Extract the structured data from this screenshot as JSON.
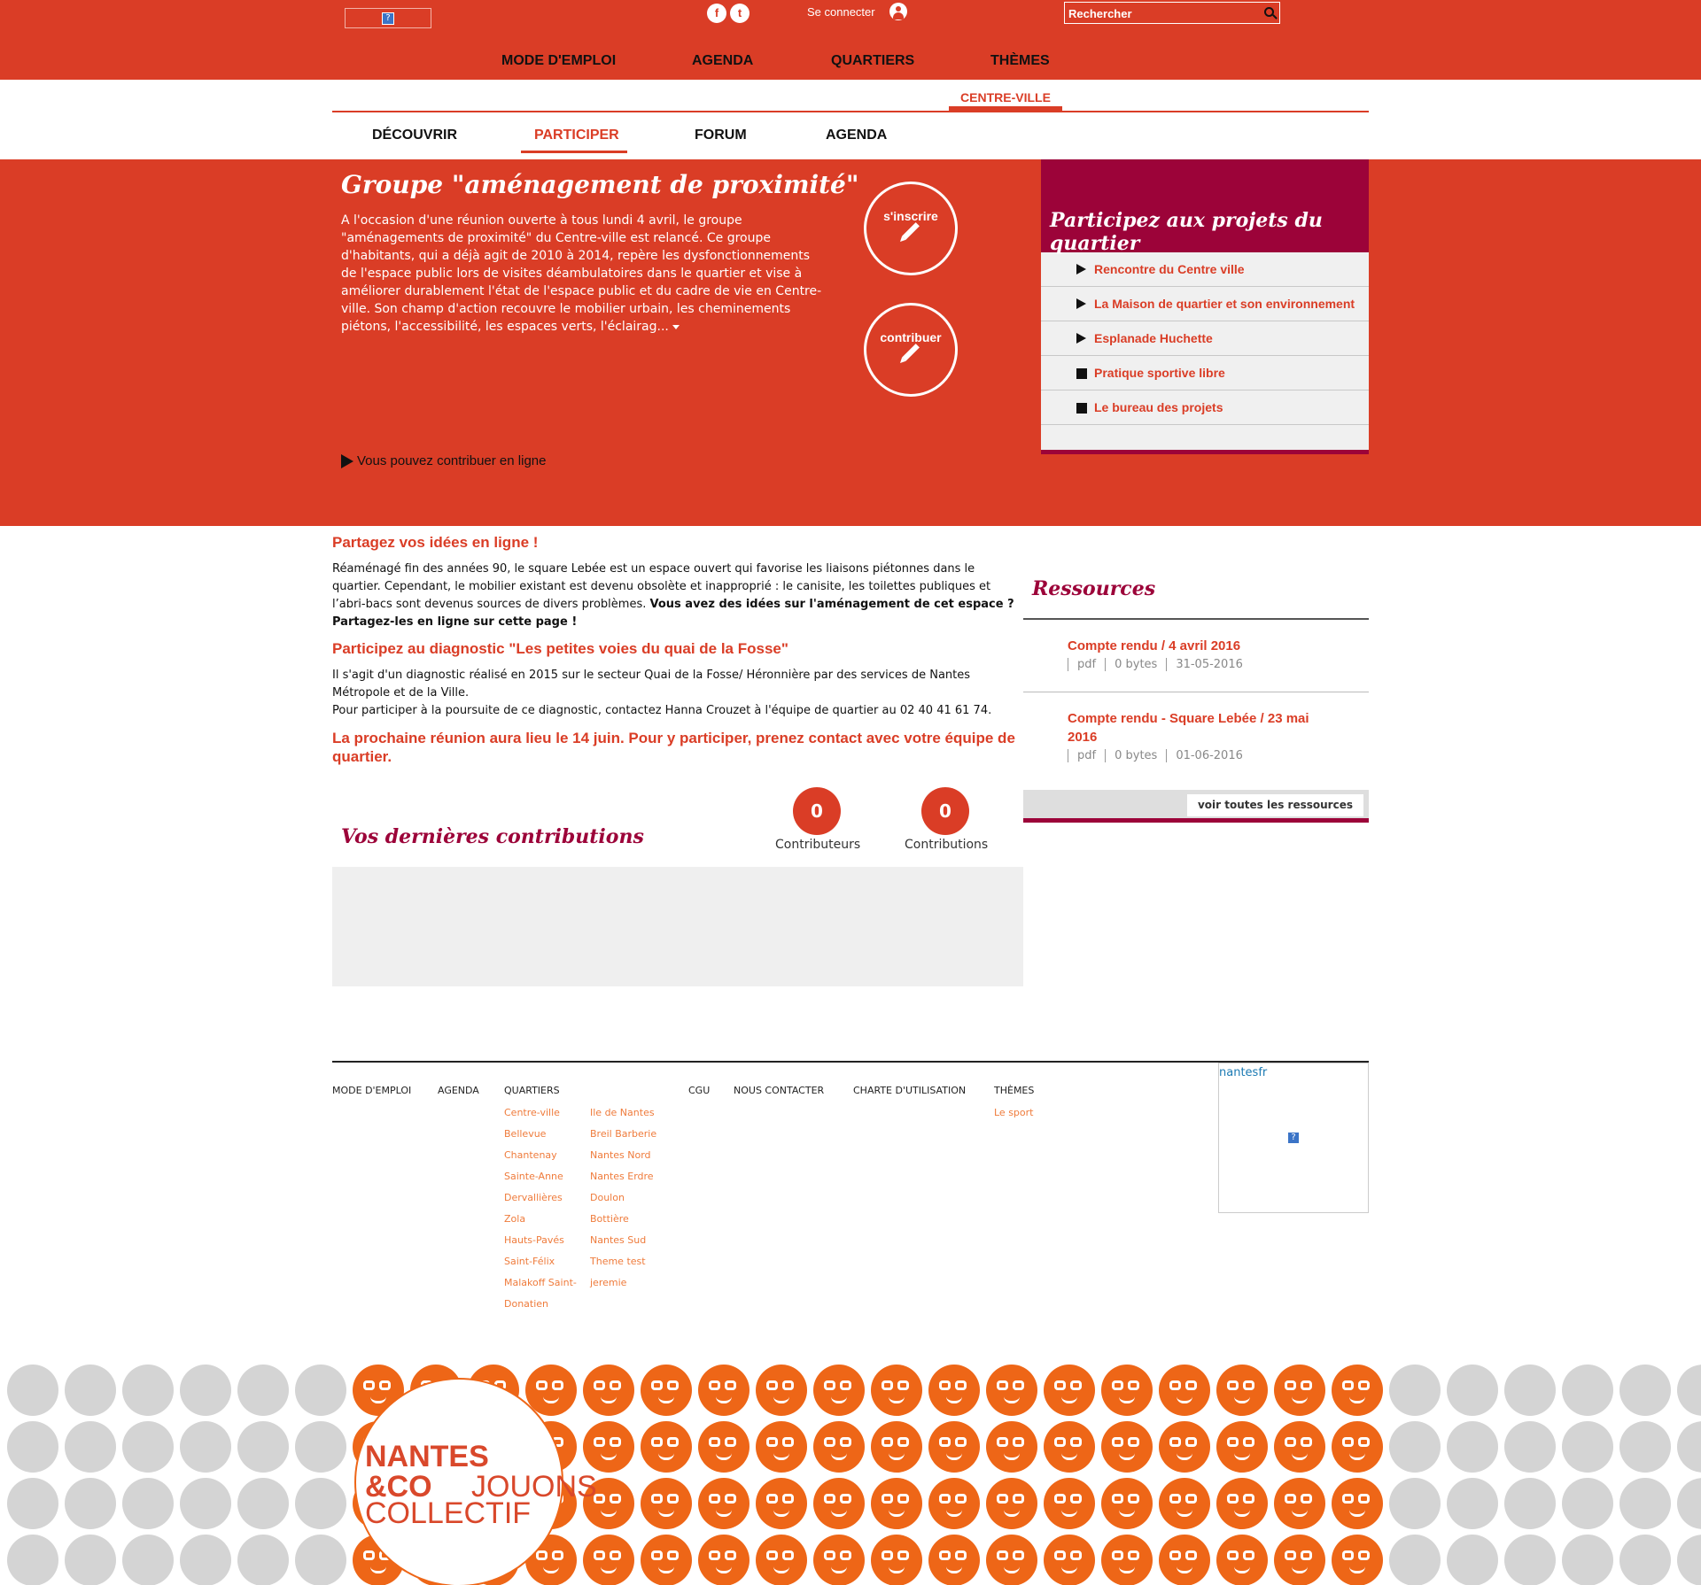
{
  "header": {
    "social": {
      "facebook": "f",
      "twitter": "t"
    },
    "login_label": "Se connecter",
    "search_placeholder": "Rechercher",
    "nav": [
      "MODE D'EMPLOI",
      "AGENDA",
      "QUARTIERS",
      "THÈMES"
    ]
  },
  "subheader": {
    "district": "CENTRE-VILLE",
    "tabs": [
      "DÉCOUVRIR",
      "PARTICIPER",
      "FORUM",
      "AGENDA"
    ],
    "active_tab": "PARTICIPER"
  },
  "hero": {
    "title": "Groupe \"aménagement de proximité\"",
    "text": "A l'occasion d'une réunion ouverte à tous lundi 4 avril, le groupe \"aménagements de proximité\" du Centre-ville est relancé. Ce groupe d'habitants, qui a déjà agit de 2010 à 2014, repère les dysfonctionnements de l'espace public lors de visites déambulatoires dans le quartier et vise à améliorer durablement l'état de l'espace public et du cadre de vie en Centre-ville. Son champ d'action recouvre le mobilier urbain, les cheminements piétons, l'accessibilité, les espaces verts, l'éclairag...",
    "subscribe_label": "s'inscrire",
    "contribute_label": "contribuer",
    "contribute_online": "Vous pouvez contribuer en ligne"
  },
  "projects": {
    "title": "Participez aux projets du quartier",
    "items": [
      {
        "label": "Rencontre du Centre ville",
        "marker": "triangle"
      },
      {
        "label": "La Maison de quartier et son environnement",
        "marker": "triangle"
      },
      {
        "label": "Esplanade Huchette",
        "marker": "triangle"
      },
      {
        "label": "Pratique sportive libre",
        "marker": "square"
      },
      {
        "label": "Le bureau des projets",
        "marker": "square"
      }
    ]
  },
  "content": {
    "section1_title": "Partagez vos idées en ligne !",
    "section1_text": "Réaménagé fin des années 90, le square Lebée est un espace ouvert qui favorise les liaisons piétonnes dans le quartier. Cependant, le mobilier existant est devenu obsolète et inapproprié : le canisite, les toilettes publiques et l’abri-bacs sont devenus sources de divers problèmes.",
    "section1_bold": "Vous avez des idées sur l'aménagement de cet espace ? Partagez-les en ligne sur cette page !",
    "section2_title": "Participez au diagnostic \"Les petites voies du quai de la Fosse\"",
    "section2_text1": "Il s'agit d'un diagnostic réalisé en 2015 sur le secteur Quai de la Fosse/ Héronnière par des services de Nantes Métropole et de la Ville.",
    "section2_text2": "Pour participer à la poursuite de ce diagnostic, contactez Hanna Crouzet à l'équipe de quartier au 02 40 41 61 74.",
    "section3_title": "La prochaine réunion aura lieu le 14 juin. Pour y participer, prenez contact avec votre équipe de quartier."
  },
  "resources": {
    "title": "Ressources",
    "items": [
      {
        "name": "Compte rendu / 4 avril 2016",
        "type": "pdf",
        "size": "0 bytes",
        "date": "31-05-2016"
      },
      {
        "name": "Compte rendu - Square Lebée / 23 mai 2016",
        "type": "pdf",
        "size": "0 bytes",
        "date": "01-06-2016"
      }
    ],
    "view_all": "voir toutes les ressources"
  },
  "contributions": {
    "title": "Vos dernières contributions",
    "contributors_count": "0",
    "contributors_label": "Contributeurs",
    "contributions_count": "0",
    "contributions_label": "Contributions"
  },
  "footer": {
    "nav": [
      "MODE D'EMPLOI",
      "AGENDA",
      "QUARTIERS",
      "CGU",
      "NOUS CONTACTER",
      "CHARTE D'UTILISATION",
      "THÈMES"
    ],
    "quartiers_col1": [
      "Centre-ville",
      "Bellevue",
      "Chantenay",
      "Sainte-Anne",
      "Dervallières",
      "Zola",
      "Hauts-Pavés",
      "Saint-Félix",
      "Malakoff Saint-",
      "Donatien"
    ],
    "quartiers_col2": [
      "Ile de Nantes",
      "Breil Barberie",
      "Nantes Nord",
      "Nantes Erdre",
      "Doulon",
      "Bottière",
      "Nantes Sud",
      "Theme test",
      "jeremie"
    ],
    "themes": [
      "Le sport"
    ],
    "nantes_link": "nantesfr"
  },
  "banner": {
    "brand_line1": "NANTES",
    "brand_line2": "&CO",
    "brand_line3": "JOUONS",
    "brand_line4": "COLLECTIF"
  },
  "colors": {
    "accent": "#da3d26",
    "burgundy": "#9c0339",
    "orange": "#ee6617",
    "link_orange": "#ef7b3b"
  }
}
